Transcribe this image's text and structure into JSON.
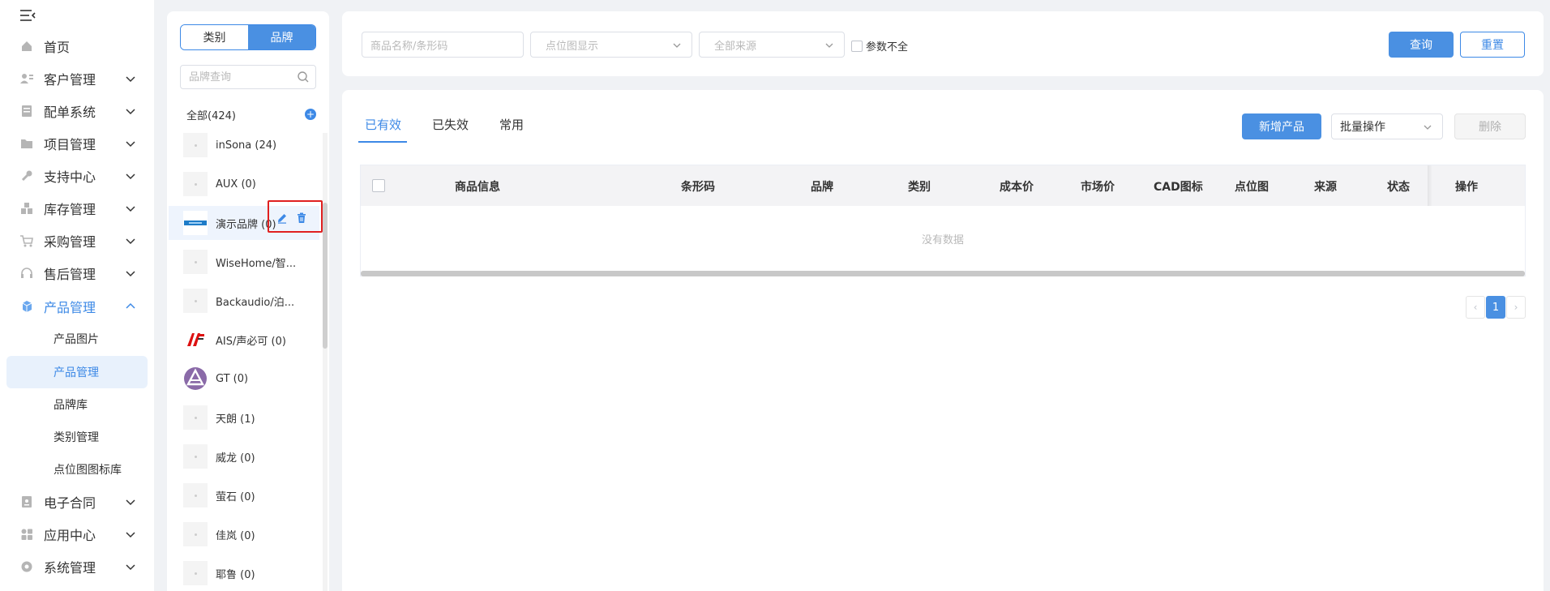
{
  "sidebar": {
    "toggle_icon": "menu-fold-icon",
    "items": [
      {
        "label": "首页",
        "icon": "home-icon",
        "has_chevron": false
      },
      {
        "label": "客户管理",
        "icon": "customer-icon",
        "has_chevron": true
      },
      {
        "label": "配单系统",
        "icon": "order-icon",
        "has_chevron": true
      },
      {
        "label": "项目管理",
        "icon": "folder-icon",
        "has_chevron": true
      },
      {
        "label": "支持中心",
        "icon": "wrench-icon",
        "has_chevron": true
      },
      {
        "label": "库存管理",
        "icon": "inventory-icon",
        "has_chevron": true
      },
      {
        "label": "采购管理",
        "icon": "cart-icon",
        "has_chevron": true
      },
      {
        "label": "售后管理",
        "icon": "headset-icon",
        "has_chevron": true
      },
      {
        "label": "产品管理",
        "icon": "cube-icon",
        "has_chevron": true,
        "open": true
      },
      {
        "label": "电子合同",
        "icon": "contract-icon",
        "has_chevron": true
      },
      {
        "label": "应用中心",
        "icon": "apps-icon",
        "has_chevron": true
      },
      {
        "label": "系统管理",
        "icon": "settings-icon",
        "has_chevron": true
      }
    ],
    "sub_items": [
      {
        "label": "产品图片"
      },
      {
        "label": "产品管理",
        "active": true
      },
      {
        "label": "品牌库"
      },
      {
        "label": "类别管理"
      },
      {
        "label": "点位图图标库"
      }
    ]
  },
  "brand_panel": {
    "segment": {
      "category": "类别",
      "brand": "品牌"
    },
    "search_placeholder": "品牌查询",
    "all_label": "全部(424)",
    "add_icon": "+",
    "brands": [
      {
        "name": "inSona (24)",
        "logo": "placeholder"
      },
      {
        "name": "AUX (0)",
        "logo": "placeholder"
      },
      {
        "name": "演示品牌 (0)",
        "logo": "demo-logo",
        "active": true
      },
      {
        "name": "WiseHome/智...",
        "logo": "placeholder"
      },
      {
        "name": "Backaudio/泊...",
        "logo": "placeholder"
      },
      {
        "name": "AIS/声必可 (0)",
        "logo": "ais-logo"
      },
      {
        "name": "GT (0)",
        "logo": "gt-logo"
      },
      {
        "name": "天朗 (1)",
        "logo": "placeholder"
      },
      {
        "name": "威龙 (0)",
        "logo": "placeholder"
      },
      {
        "name": "萤石 (0)",
        "logo": "placeholder"
      },
      {
        "name": "佳岚 (0)",
        "logo": "placeholder"
      },
      {
        "name": "耶鲁 (0)",
        "logo": "placeholder"
      }
    ]
  },
  "filters": {
    "keyword_placeholder": "商品名称/条形码",
    "point_map_placeholder": "点位图显示",
    "source_placeholder": "全部来源",
    "incomplete_label": "参数不全",
    "query_label": "查询",
    "reset_label": "重置"
  },
  "main": {
    "tabs": [
      {
        "label": "已有效",
        "active": true
      },
      {
        "label": "已失效"
      },
      {
        "label": "常用"
      }
    ],
    "add_product_label": "新增产品",
    "batch_label": "批量操作",
    "delete_label": "删除",
    "columns": [
      "商品信息",
      "条形码",
      "品牌",
      "类别",
      "成本价",
      "市场价",
      "CAD图标",
      "点位图",
      "来源",
      "状态",
      "操作"
    ],
    "empty_text": "没有数据",
    "pagination": {
      "current": "1",
      "prev": "‹",
      "next": "›"
    }
  },
  "colors": {
    "accent": "#3d89e6",
    "primary_button": "#4a90e2",
    "highlight_border": "#e02020"
  }
}
